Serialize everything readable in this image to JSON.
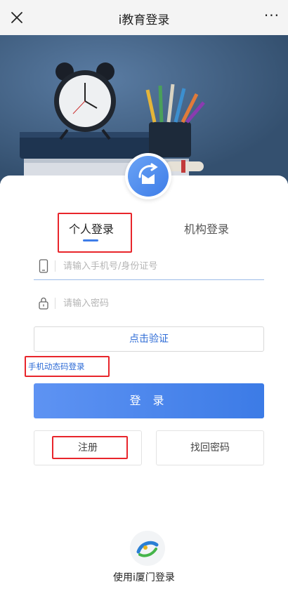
{
  "header": {
    "close_icon": "close-icon",
    "title": "i教育登录",
    "more_label": "···"
  },
  "hero": {
    "image": "alarm-clock-books-pencils-photo"
  },
  "badge": {
    "icon": "education-logo-icon"
  },
  "tabs": [
    {
      "label": "个人登录",
      "active": true
    },
    {
      "label": "机构登录",
      "active": false
    }
  ],
  "form": {
    "phone_placeholder": "请输入手机号/身份证号",
    "phone_icon": "phone-icon",
    "password_placeholder": "请输入密码",
    "password_icon": "lock-icon",
    "verify_label": "点击验证",
    "dynamic_link": "手机动态码登录",
    "login_label": "登 录",
    "register_label": "注册",
    "forgot_label": "找回密码"
  },
  "footer": {
    "logo_icon": "ixiamen-logo-icon",
    "label": "使用i厦门登录"
  },
  "colors": {
    "accent": "#3e7de8",
    "highlight": "#e8252b",
    "link": "#2d6bd6"
  }
}
